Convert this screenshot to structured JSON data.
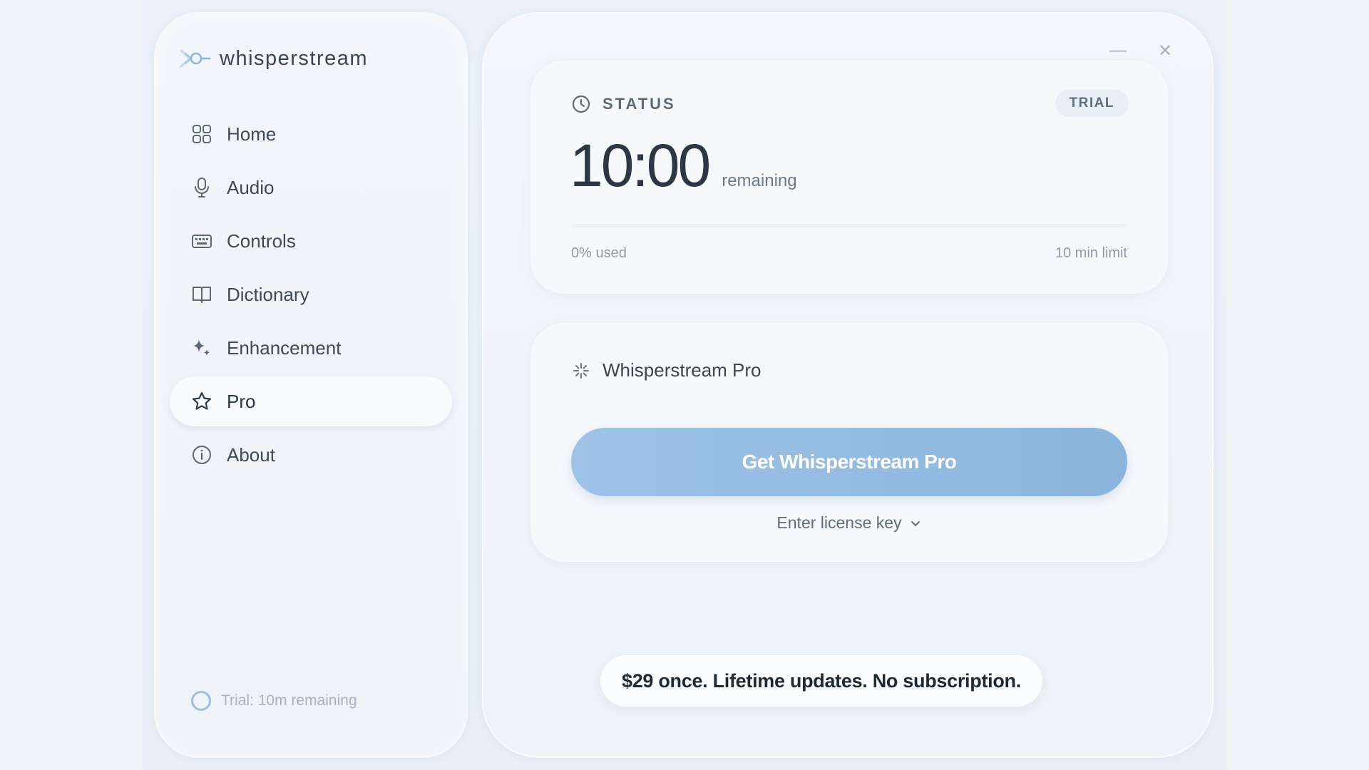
{
  "app": {
    "name": "whisperstream"
  },
  "window": {
    "minimize_glyph": "—",
    "close_glyph": "✕"
  },
  "sidebar": {
    "items": [
      {
        "label": "Home",
        "icon": "grid-icon"
      },
      {
        "label": "Audio",
        "icon": "microphone-icon"
      },
      {
        "label": "Controls",
        "icon": "keyboard-icon"
      },
      {
        "label": "Dictionary",
        "icon": "book-icon"
      },
      {
        "label": "Enhancement",
        "icon": "sparkles-icon"
      },
      {
        "label": "Pro",
        "icon": "star-icon",
        "active": true
      },
      {
        "label": "About",
        "icon": "info-icon"
      }
    ],
    "trial_status": "Trial: 10m remaining"
  },
  "status": {
    "label": "STATUS",
    "badge": "TRIAL",
    "time": "10:00",
    "time_suffix": "remaining",
    "used_text": "0% used",
    "limit_text": "10 min limit",
    "used_fraction": 0
  },
  "pro": {
    "title": "Whisperstream Pro",
    "cta_label": "Get Whisperstream Pro",
    "license_label": "Enter license key"
  },
  "pricing": {
    "text": "$29 once. Lifetime updates. No subscription."
  },
  "colors": {
    "accent": "#9fc3e6",
    "accent_dark": "#8bb4dd",
    "text": "#2f3a48"
  }
}
